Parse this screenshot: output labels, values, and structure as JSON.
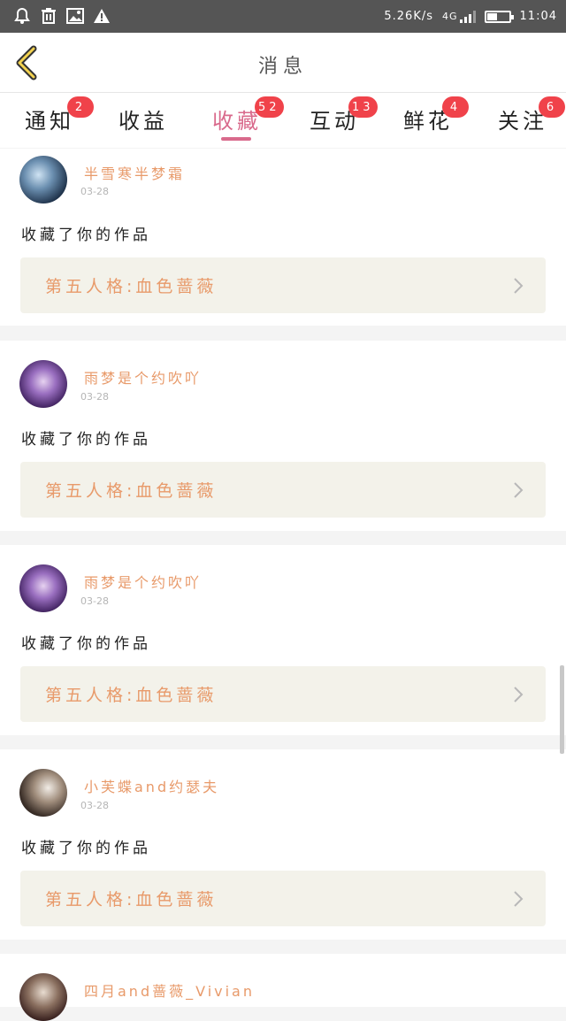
{
  "status_bar": {
    "left_icons": [
      "alarm-icon",
      "trash-icon",
      "image-icon",
      "warning-icon"
    ],
    "speed": "5.26K/s",
    "network": "4G",
    "battery_level": 0.45,
    "time": "11:04"
  },
  "header": {
    "back_icon": "chevron-left-icon",
    "title": "消息"
  },
  "tabs": [
    {
      "label": "通知",
      "badge": "2",
      "active": false
    },
    {
      "label": "收益",
      "badge": "",
      "active": false
    },
    {
      "label": "收藏",
      "badge": "52",
      "active": true
    },
    {
      "label": "互动",
      "badge": "13",
      "active": false
    },
    {
      "label": "鲜花",
      "badge": "4",
      "active": false
    },
    {
      "label": "关注",
      "badge": "6",
      "active": false
    }
  ],
  "colors": {
    "accent": "#d96a8c",
    "badge": "#f0424a",
    "username": "#e89a6a",
    "work_bg": "#f3f2ea"
  },
  "feed": [
    {
      "user": "半雪寒半梦霜",
      "date": "03-28",
      "action": "收藏了你的作品",
      "work": "第五人格:血色蔷薇"
    },
    {
      "user": "雨梦是个约吹吖",
      "date": "03-28",
      "action": "收藏了你的作品",
      "work": "第五人格:血色蔷薇"
    },
    {
      "user": "雨梦是个约吹吖",
      "date": "03-28",
      "action": "收藏了你的作品",
      "work": "第五人格:血色蔷薇"
    },
    {
      "user": "小芙蝶and约瑟夫",
      "date": "03-28",
      "action": "收藏了你的作品",
      "work": "第五人格:血色蔷薇"
    },
    {
      "user": "四月and蔷薇_Vivian",
      "date": "",
      "action": "",
      "work": ""
    }
  ]
}
